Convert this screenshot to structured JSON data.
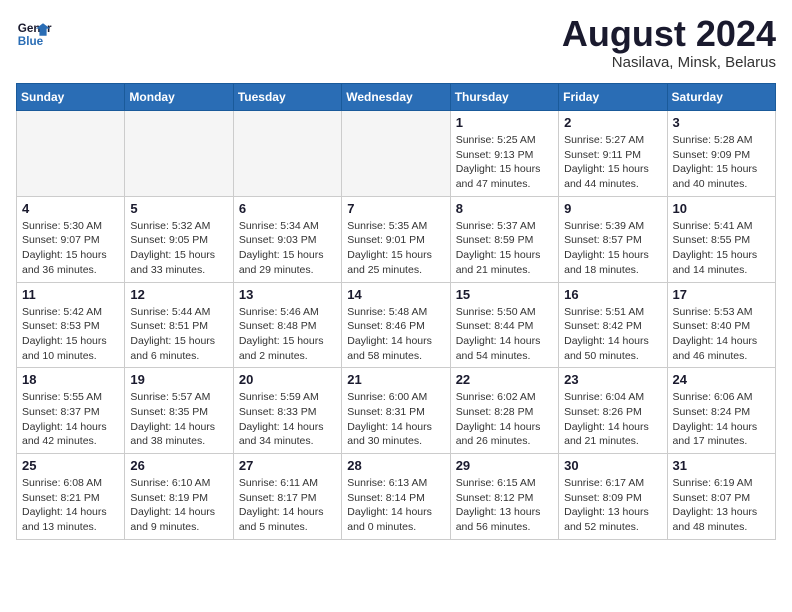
{
  "header": {
    "logo_line1": "General",
    "logo_line2": "Blue",
    "month_title": "August 2024",
    "location": "Nasilava, Minsk, Belarus"
  },
  "weekdays": [
    "Sunday",
    "Monday",
    "Tuesday",
    "Wednesday",
    "Thursday",
    "Friday",
    "Saturday"
  ],
  "weeks": [
    [
      {
        "day": "",
        "info": ""
      },
      {
        "day": "",
        "info": ""
      },
      {
        "day": "",
        "info": ""
      },
      {
        "day": "",
        "info": ""
      },
      {
        "day": "1",
        "info": "Sunrise: 5:25 AM\nSunset: 9:13 PM\nDaylight: 15 hours\nand 47 minutes."
      },
      {
        "day": "2",
        "info": "Sunrise: 5:27 AM\nSunset: 9:11 PM\nDaylight: 15 hours\nand 44 minutes."
      },
      {
        "day": "3",
        "info": "Sunrise: 5:28 AM\nSunset: 9:09 PM\nDaylight: 15 hours\nand 40 minutes."
      }
    ],
    [
      {
        "day": "4",
        "info": "Sunrise: 5:30 AM\nSunset: 9:07 PM\nDaylight: 15 hours\nand 36 minutes."
      },
      {
        "day": "5",
        "info": "Sunrise: 5:32 AM\nSunset: 9:05 PM\nDaylight: 15 hours\nand 33 minutes."
      },
      {
        "day": "6",
        "info": "Sunrise: 5:34 AM\nSunset: 9:03 PM\nDaylight: 15 hours\nand 29 minutes."
      },
      {
        "day": "7",
        "info": "Sunrise: 5:35 AM\nSunset: 9:01 PM\nDaylight: 15 hours\nand 25 minutes."
      },
      {
        "day": "8",
        "info": "Sunrise: 5:37 AM\nSunset: 8:59 PM\nDaylight: 15 hours\nand 21 minutes."
      },
      {
        "day": "9",
        "info": "Sunrise: 5:39 AM\nSunset: 8:57 PM\nDaylight: 15 hours\nand 18 minutes."
      },
      {
        "day": "10",
        "info": "Sunrise: 5:41 AM\nSunset: 8:55 PM\nDaylight: 15 hours\nand 14 minutes."
      }
    ],
    [
      {
        "day": "11",
        "info": "Sunrise: 5:42 AM\nSunset: 8:53 PM\nDaylight: 15 hours\nand 10 minutes."
      },
      {
        "day": "12",
        "info": "Sunrise: 5:44 AM\nSunset: 8:51 PM\nDaylight: 15 hours\nand 6 minutes."
      },
      {
        "day": "13",
        "info": "Sunrise: 5:46 AM\nSunset: 8:48 PM\nDaylight: 15 hours\nand 2 minutes."
      },
      {
        "day": "14",
        "info": "Sunrise: 5:48 AM\nSunset: 8:46 PM\nDaylight: 14 hours\nand 58 minutes."
      },
      {
        "day": "15",
        "info": "Sunrise: 5:50 AM\nSunset: 8:44 PM\nDaylight: 14 hours\nand 54 minutes."
      },
      {
        "day": "16",
        "info": "Sunrise: 5:51 AM\nSunset: 8:42 PM\nDaylight: 14 hours\nand 50 minutes."
      },
      {
        "day": "17",
        "info": "Sunrise: 5:53 AM\nSunset: 8:40 PM\nDaylight: 14 hours\nand 46 minutes."
      }
    ],
    [
      {
        "day": "18",
        "info": "Sunrise: 5:55 AM\nSunset: 8:37 PM\nDaylight: 14 hours\nand 42 minutes."
      },
      {
        "day": "19",
        "info": "Sunrise: 5:57 AM\nSunset: 8:35 PM\nDaylight: 14 hours\nand 38 minutes."
      },
      {
        "day": "20",
        "info": "Sunrise: 5:59 AM\nSunset: 8:33 PM\nDaylight: 14 hours\nand 34 minutes."
      },
      {
        "day": "21",
        "info": "Sunrise: 6:00 AM\nSunset: 8:31 PM\nDaylight: 14 hours\nand 30 minutes."
      },
      {
        "day": "22",
        "info": "Sunrise: 6:02 AM\nSunset: 8:28 PM\nDaylight: 14 hours\nand 26 minutes."
      },
      {
        "day": "23",
        "info": "Sunrise: 6:04 AM\nSunset: 8:26 PM\nDaylight: 14 hours\nand 21 minutes."
      },
      {
        "day": "24",
        "info": "Sunrise: 6:06 AM\nSunset: 8:24 PM\nDaylight: 14 hours\nand 17 minutes."
      }
    ],
    [
      {
        "day": "25",
        "info": "Sunrise: 6:08 AM\nSunset: 8:21 PM\nDaylight: 14 hours\nand 13 minutes."
      },
      {
        "day": "26",
        "info": "Sunrise: 6:10 AM\nSunset: 8:19 PM\nDaylight: 14 hours\nand 9 minutes."
      },
      {
        "day": "27",
        "info": "Sunrise: 6:11 AM\nSunset: 8:17 PM\nDaylight: 14 hours\nand 5 minutes."
      },
      {
        "day": "28",
        "info": "Sunrise: 6:13 AM\nSunset: 8:14 PM\nDaylight: 14 hours\nand 0 minutes."
      },
      {
        "day": "29",
        "info": "Sunrise: 6:15 AM\nSunset: 8:12 PM\nDaylight: 13 hours\nand 56 minutes."
      },
      {
        "day": "30",
        "info": "Sunrise: 6:17 AM\nSunset: 8:09 PM\nDaylight: 13 hours\nand 52 minutes."
      },
      {
        "day": "31",
        "info": "Sunrise: 6:19 AM\nSunset: 8:07 PM\nDaylight: 13 hours\nand 48 minutes."
      }
    ]
  ]
}
